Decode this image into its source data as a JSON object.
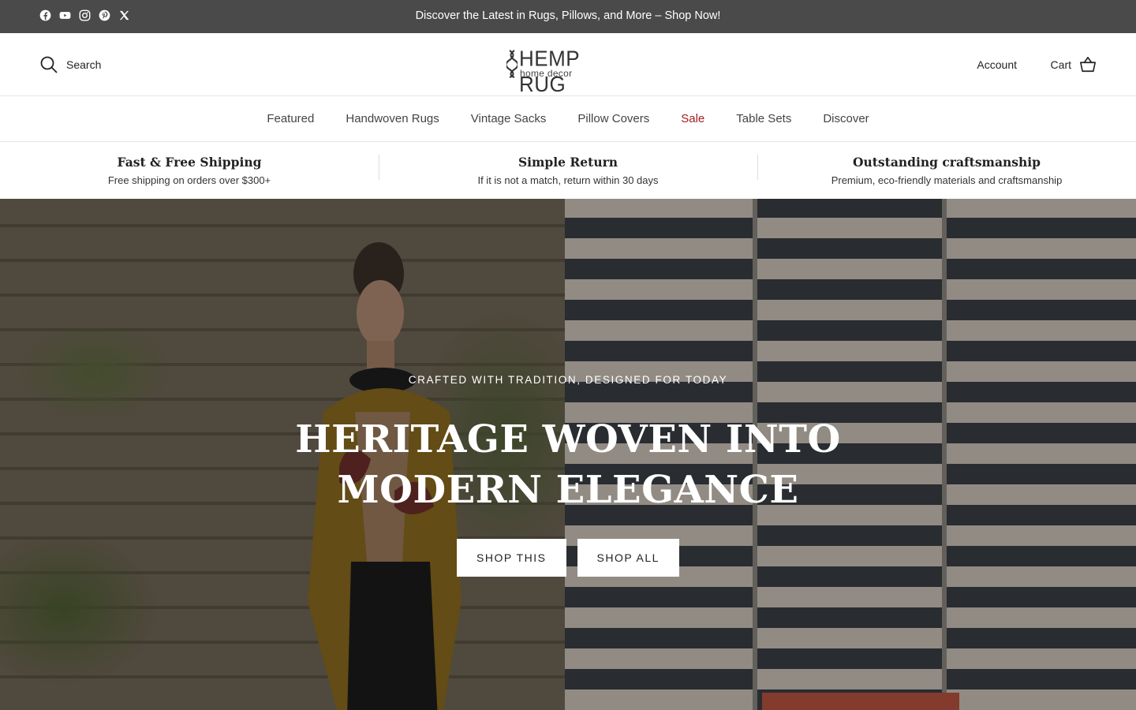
{
  "announcement": {
    "text": "Discover the Latest in Rugs, Pillows, and More – Shop Now!",
    "socials": [
      "facebook-icon",
      "youtube-icon",
      "instagram-icon",
      "pinterest-icon",
      "x-icon"
    ]
  },
  "header": {
    "search_label": "Search",
    "logo_title": "HEMP RUG",
    "logo_subtitle": "home decor",
    "account_label": "Account",
    "cart_label": "Cart"
  },
  "nav": {
    "items": [
      {
        "label": "Featured"
      },
      {
        "label": "Handwoven Rugs"
      },
      {
        "label": "Vintage Sacks"
      },
      {
        "label": "Pillow Covers"
      },
      {
        "label": "Sale"
      },
      {
        "label": "Table Sets"
      },
      {
        "label": "Discover"
      }
    ],
    "sale_color": "#a51f1f"
  },
  "usp": [
    {
      "title": "Fast & Free Shipping",
      "desc": "Free shipping on orders over $300+"
    },
    {
      "title": "Simple Return",
      "desc": "If it is not a match, return within 30 days"
    },
    {
      "title": "Outstanding craftsmanship",
      "desc": "Premium, eco-friendly materials and craftsmanship"
    }
  ],
  "hero": {
    "kicker": "CRAFTED WITH TRADITION, DESIGNED FOR TODAY",
    "headline_line1": "HERITAGE WOVEN INTO",
    "headline_line2": "MODERN ELEGANCE",
    "button_primary": "SHOP THIS",
    "button_secondary": "SHOP ALL"
  },
  "colors": {
    "announcement_bg": "#4a4a4a",
    "text": "#222222"
  }
}
